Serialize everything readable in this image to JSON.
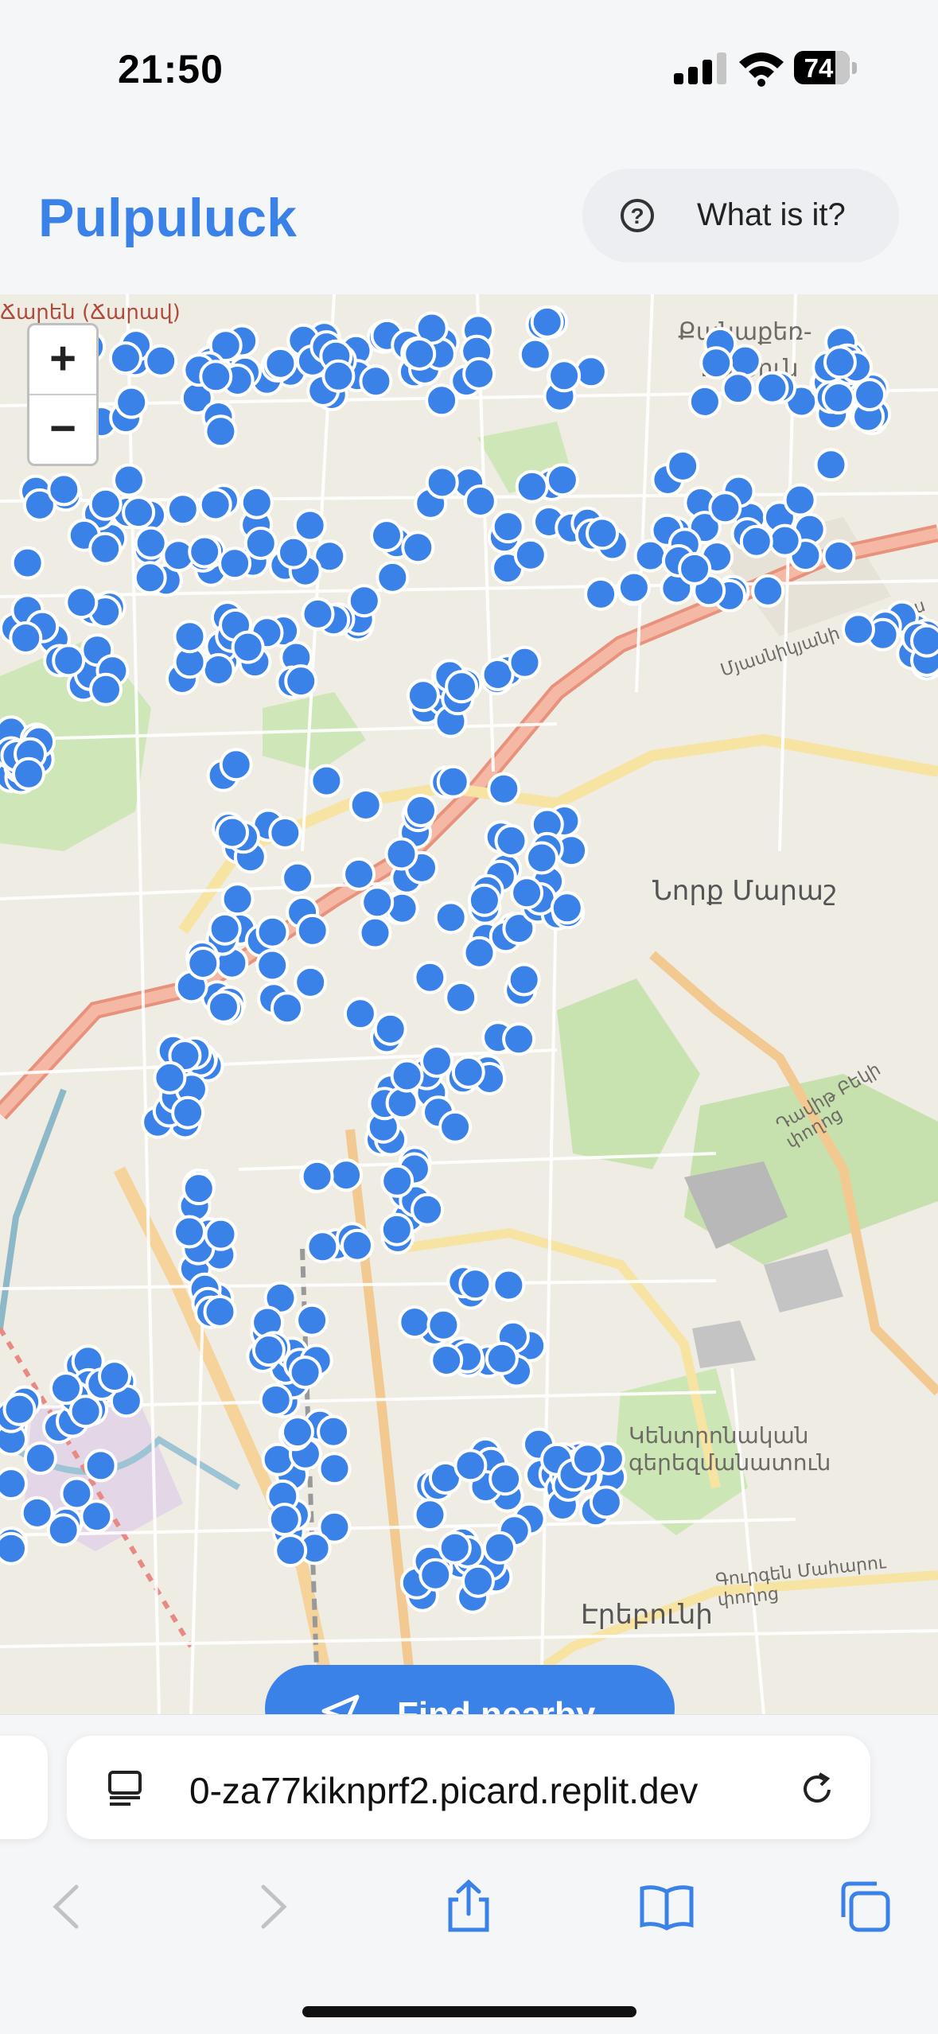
{
  "status_bar": {
    "time": "21:50",
    "battery": "74",
    "battery_level": 0.74
  },
  "header": {
    "title": "Pulpuluck",
    "info_button_label": "What is it?"
  },
  "map": {
    "zoom_in": "+",
    "zoom_out": "−",
    "labels": {
      "top_left": "Ճարեն (Ճարավ)",
      "top_right_1": "Քանաքեռ-",
      "top_right_2": "Զեյթուն",
      "nork_marash": "Նորք Մարաշ",
      "central_cemetery_1": "Կենտրոնական",
      "central_cemetery_2": "գերեզմանատուն",
      "yerevan": "Էրեբունի",
      "avenue_1": "Մյասնիկյանի պողոտա",
      "avenue_2": "Գուրգեն Մահարու փողոց",
      "street_1": "Դավիթ Բեկի փողոց"
    },
    "marker_color": "#3b82e8",
    "find_nearby_label": "Find nearby"
  },
  "browser": {
    "url": "0-za77kiknprf2.picard.replit.dev"
  }
}
